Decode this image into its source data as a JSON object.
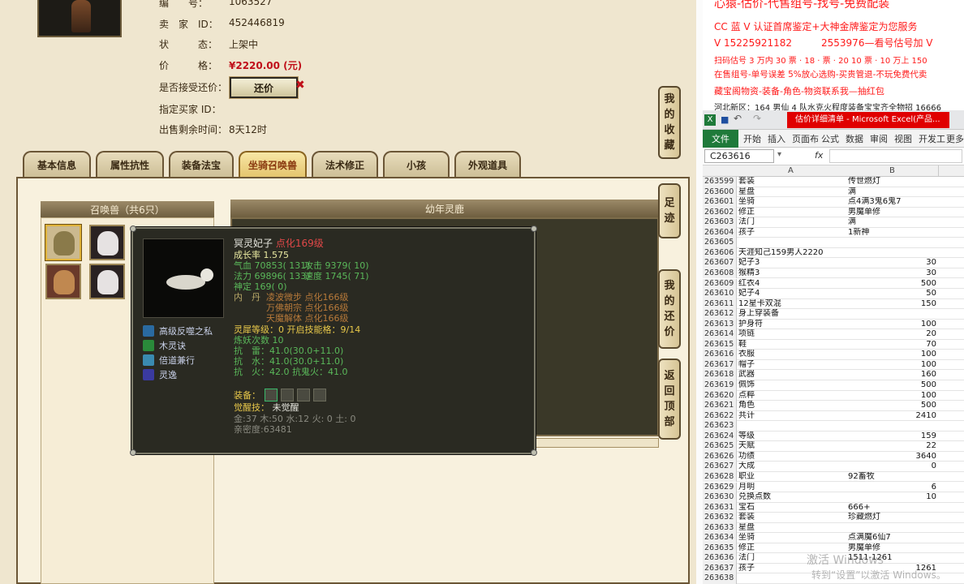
{
  "seller_info": {
    "fields": [
      {
        "label": "编　　号：",
        "value": "1063527"
      },
      {
        "label": "卖　家　ID：",
        "value": "452446819"
      },
      {
        "label": "状　　　态：",
        "value": "上架中"
      },
      {
        "label": "价　　　格：",
        "value": "¥2220.00 (元)"
      },
      {
        "label": "是否接受还价：",
        "value": ""
      },
      {
        "label": "指定买家 ID：",
        "value": ""
      },
      {
        "label": "出售剩余时间：",
        "value": "8天12时"
      }
    ],
    "haggle_button": "还价",
    "price_color": "#c0101a"
  },
  "tabs": [
    "基本信息",
    "属性抗性",
    "装备法宝",
    "坐骑召唤兽",
    "法术修正",
    "小孩",
    "外观道具"
  ],
  "active_tab": 3,
  "summon_panel": {
    "title": "召唤兽（共6只）"
  },
  "young_panel": {
    "title": "幼年灵鹿"
  },
  "side_buttons": [
    [
      "我",
      "的",
      "收",
      "藏"
    ],
    [
      "足",
      "迹"
    ],
    [
      "我",
      "的",
      "还",
      "价"
    ],
    [
      "返",
      "回",
      "顶",
      "部"
    ]
  ],
  "tooltip": {
    "name": "冥灵妃子",
    "name_suffix": "点化169级",
    "growth": "成长率 1.575",
    "hp": "气血 70853( 131)",
    "attack": "攻击 9379( 10)",
    "mp": "法力 69896( 133)",
    "speed": "速度 1745( 71)",
    "shen": "神定 169( 0)",
    "neidan": [
      {
        "prefix": "内　丹",
        "text": "凌波微步 点化166级"
      },
      {
        "prefix": "",
        "text": "万佛朝宗 点化166级"
      },
      {
        "prefix": "",
        "text": "天魔解体 点化166级"
      }
    ],
    "skills": [
      "高级反噬之私",
      "木灵诀",
      "倍道兼行",
      "灵逸"
    ],
    "lingxi": "灵犀等级：0 开启技能格：9/14",
    "lianyao": "炼妖次数 10",
    "resists": [
      "抗　雷：41.0(30.0+11.0)",
      "抗　水：41.0(30.0+11.0)",
      "抗　火：42.0 抗鬼火：41.0"
    ],
    "equip_label": "装备：",
    "awaken": "觉醒技：",
    "awaken_value": "未觉醒",
    "elements": "金:37 木:50 水:12 火: 0 土: 0",
    "intimacy": "亲密度:63481"
  },
  "ad": {
    "line1": "心猿-估价-代售组号-找号-免费配装",
    "line2": "CC 蓝 V 认证首席鉴定+大神金牌鉴定为您服务",
    "line3": "V 15225921182　　　2553976—看号估号加 V",
    "line4": "扫码估号 3 万内 30 票 · 18 · 票 · 20 10 票 · 10 万上 150",
    "line5": "在售组号-单号误差 5%放心选购-买贵管退-不玩免费代卖",
    "line6": "藏宝阁物资-装备-角色-物资联系我—抽红包",
    "line7": "河北新区：164 男仙 4 队水克火程度装备宝宝齐全物招 16666"
  },
  "excel": {
    "title_badge": "估价详细清单 - Microsoft Excel(产品...",
    "ribbon_tabs": [
      "文件",
      "开始",
      "插入",
      "页面布",
      "公式",
      "数据",
      "审阅",
      "视图",
      "开发工",
      "更多"
    ],
    "name_box": "C263616",
    "fx": "fx",
    "col_a": "A",
    "col_b": "B",
    "rows": [
      [
        "263599",
        "套装",
        "传世燃灯"
      ],
      [
        "263600",
        "星盘",
        "满"
      ],
      [
        "263601",
        "坐骑",
        "点4满3鬼6鬼7"
      ],
      [
        "263602",
        "修正",
        "男魔单修"
      ],
      [
        "263603",
        "法门",
        "满"
      ],
      [
        "263604",
        "孩子",
        "1新神"
      ],
      [
        "263605",
        "",
        ""
      ],
      [
        "263606",
        "天涯知己159男人2220",
        ""
      ],
      [
        "263607",
        "妃子3",
        "30"
      ],
      [
        "263608",
        "猴精3",
        "30"
      ],
      [
        "263609",
        "红衣4",
        "500"
      ],
      [
        "263610",
        "妃子4",
        "50"
      ],
      [
        "263611",
        "12星卡双混",
        "150"
      ],
      [
        "263612",
        "身上穿装备",
        ""
      ],
      [
        "263613",
        "护身符",
        "100"
      ],
      [
        "263614",
        "项链",
        "20"
      ],
      [
        "263615",
        "鞋",
        "70"
      ],
      [
        "263616",
        "衣服",
        "100"
      ],
      [
        "263617",
        "帽子",
        "100"
      ],
      [
        "263618",
        "武器",
        "160"
      ],
      [
        "263619",
        "佩饰",
        "500"
      ],
      [
        "263620",
        "点粹",
        "100"
      ],
      [
        "263621",
        "角色",
        "500"
      ],
      [
        "263622",
        "共计",
        "2410"
      ],
      [
        "263623",
        "",
        ""
      ],
      [
        "263624",
        "等级",
        "159"
      ],
      [
        "263625",
        "天赋",
        "22"
      ],
      [
        "263626",
        "功绩",
        "3640"
      ],
      [
        "263627",
        "大成",
        "0"
      ],
      [
        "263628",
        "职业",
        "92畜牧"
      ],
      [
        "263629",
        "月明",
        "6"
      ],
      [
        "263630",
        "兑换点数",
        "10"
      ],
      [
        "263631",
        "宝石",
        "666+"
      ],
      [
        "263632",
        "套装",
        "珍藏燃灯"
      ],
      [
        "263633",
        "星盘",
        ""
      ],
      [
        "263634",
        "坐骑",
        "点满魔6仙7"
      ],
      [
        "263635",
        "修正",
        "男魔单修"
      ],
      [
        "263636",
        "法门",
        "1511-1261"
      ],
      [
        "263637",
        "孩子",
        "1261"
      ],
      [
        "263638",
        "",
        ""
      ]
    ]
  },
  "watermark": {
    "line1": "激活 Windows",
    "line2": "转到“设置”以激活 Windows。"
  }
}
